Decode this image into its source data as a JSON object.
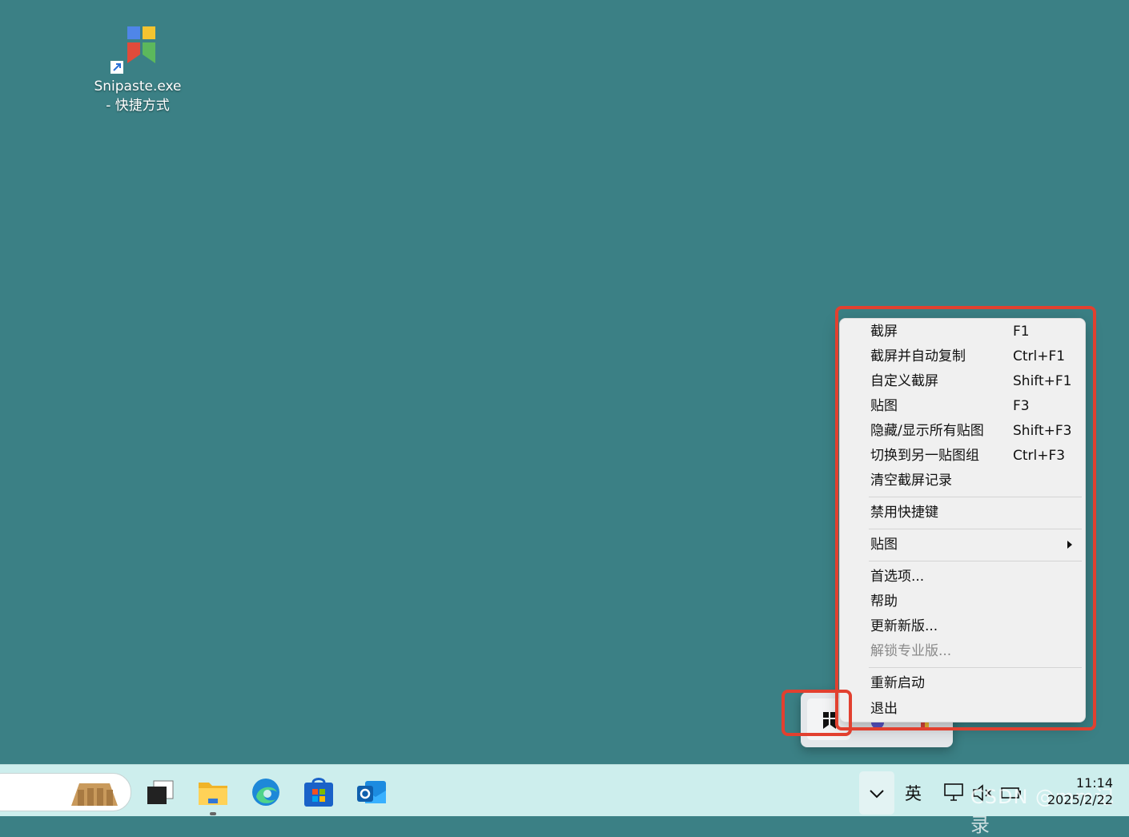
{
  "desktop": {
    "icon_label_line1": "Snipaste.exe",
    "icon_label_line2": "- 快捷方式"
  },
  "menu": {
    "items": [
      {
        "label": "截屏",
        "shortcut": "F1"
      },
      {
        "label": "截屏并自动复制",
        "shortcut": "Ctrl+F1"
      },
      {
        "label": "自定义截屏",
        "shortcut": "Shift+F1"
      },
      {
        "label": "贴图",
        "shortcut": "F3"
      },
      {
        "label": "隐藏/显示所有贴图",
        "shortcut": "Shift+F3"
      },
      {
        "label": "切换到另一贴图组",
        "shortcut": "Ctrl+F3"
      },
      {
        "label": "清空截屏记录",
        "shortcut": ""
      },
      {
        "label": "禁用快捷键",
        "shortcut": ""
      },
      {
        "label": "贴图",
        "shortcut": ""
      },
      {
        "label": "首选项...",
        "shortcut": ""
      },
      {
        "label": "帮助",
        "shortcut": ""
      },
      {
        "label": "更新新版...",
        "shortcut": ""
      },
      {
        "label": "解锁专业版...",
        "shortcut": "",
        "disabled": true
      },
      {
        "label": "重新启动",
        "shortcut": ""
      },
      {
        "label": "退出",
        "shortcut": ""
      }
    ]
  },
  "taskbar": {
    "ime": "英",
    "time": "11:14",
    "date": "2025/2/22",
    "watermark": "CSDN @mm记录"
  },
  "colors": {
    "desktop_bg": "#3b8085",
    "highlight": "#e2402f",
    "menu_bg": "#f0f0f0",
    "taskbar_bg": "#cdeeed"
  }
}
